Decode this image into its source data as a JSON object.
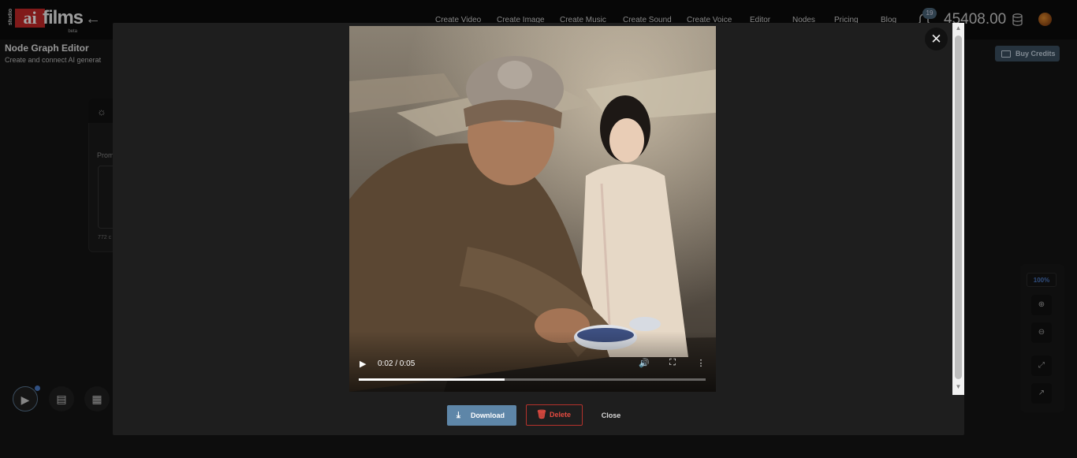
{
  "header": {
    "logo": {
      "studio": "studio",
      "ai": "ai",
      "films": "films",
      "beta": "beta"
    },
    "nav": [
      "Create Video",
      "Create Image",
      "Create Music",
      "Create Sound",
      "Create Voice",
      "Editor",
      "Nodes",
      "Pricing",
      "Blog"
    ],
    "notifications_count": "19",
    "credits": "45408.00"
  },
  "page": {
    "title": "Node Graph Editor",
    "subtitle": "Create and connect AI generat",
    "buy_credits": "Buy Credits"
  },
  "node": {
    "prompt_label": "Prom",
    "char_count": "772 c"
  },
  "zoom": {
    "level": "100%"
  },
  "modal": {
    "video": {
      "time": "0:02 / 0:05",
      "progress": 0.42
    },
    "download_label": "Download",
    "delete_label": "Delete",
    "close_label": "Close"
  },
  "colors": {
    "accent": "#5e86a8",
    "danger": "#e24a40",
    "brand_red": "#c62828"
  }
}
